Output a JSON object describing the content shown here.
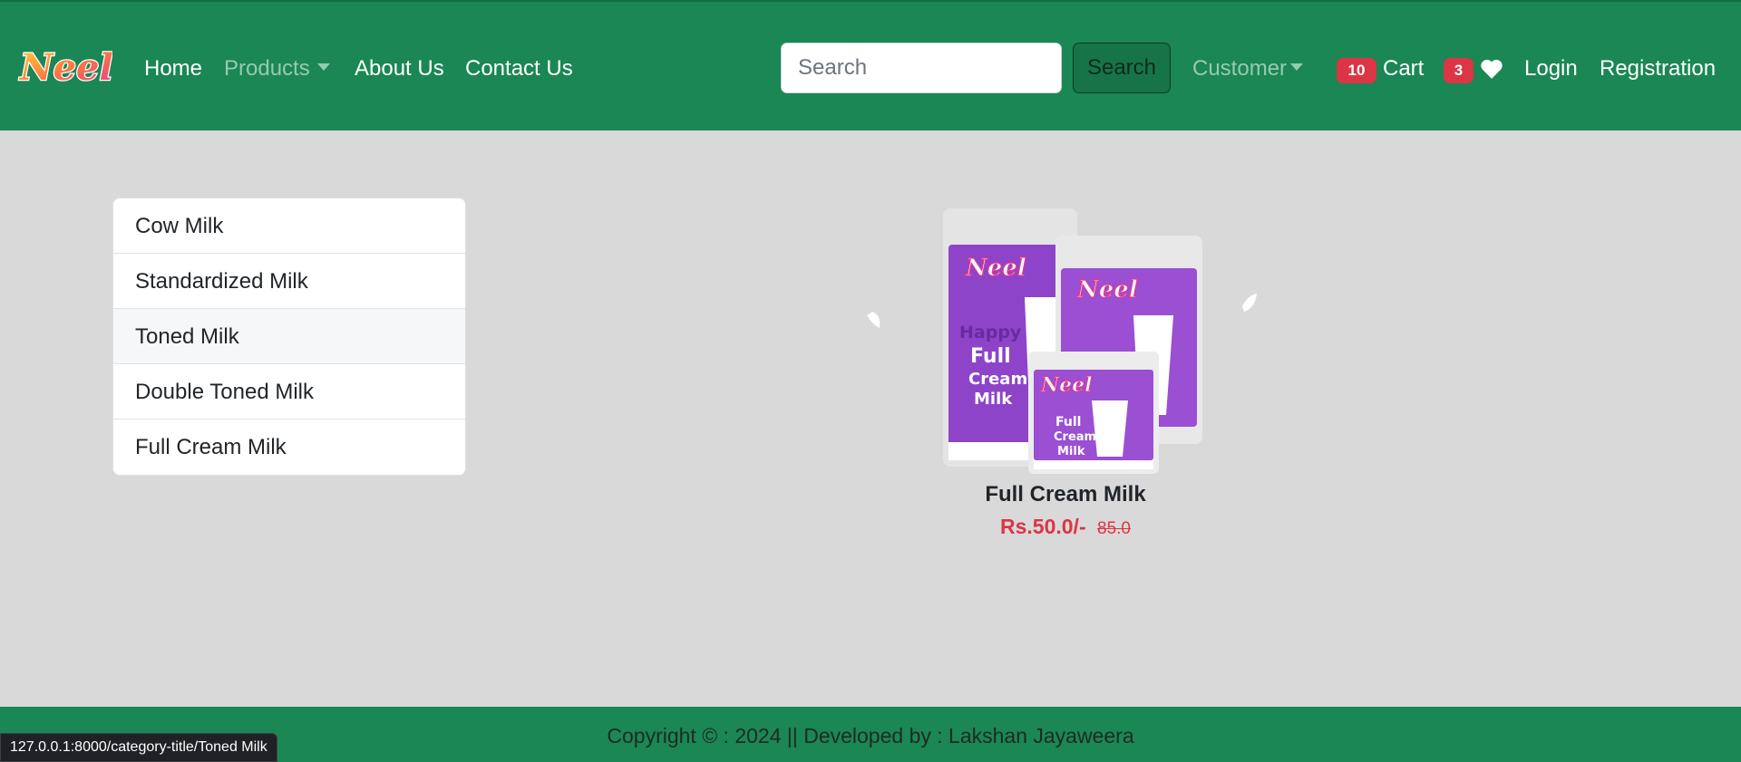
{
  "brand": {
    "logo_text": "Neel"
  },
  "nav": {
    "home": "Home",
    "products": "Products",
    "about": "About Us",
    "contact": "Contact Us",
    "customer": "Customer",
    "cart": "Cart",
    "cart_count": "10",
    "wishlist_count": "3",
    "login": "Login",
    "registration": "Registration"
  },
  "search": {
    "placeholder": "Search",
    "button_label": "Search"
  },
  "categories": [
    {
      "label": "Cow Milk"
    },
    {
      "label": "Standardized Milk"
    },
    {
      "label": "Toned Milk"
    },
    {
      "label": "Double Toned Milk"
    },
    {
      "label": "Full Cream Milk"
    }
  ],
  "product": {
    "name": "Full Cream Milk",
    "price": "Rs.50.0/-",
    "old_price": "85.0",
    "package_brand": "Neel",
    "package_text": [
      "Happy",
      "Full",
      "Cream",
      "Milk"
    ]
  },
  "footer": {
    "text": "Copyright © : 2024 || Developed by : Lakshan Jayaweera"
  },
  "status_bar": {
    "url": "127.0.0.1:8000/category-title/Toned Milk"
  },
  "colors": {
    "navbar": "#1a8754",
    "badge": "#dc3545",
    "price": "#dc3545",
    "page_background": "#d9d9d9",
    "package": "#8e44c9"
  }
}
